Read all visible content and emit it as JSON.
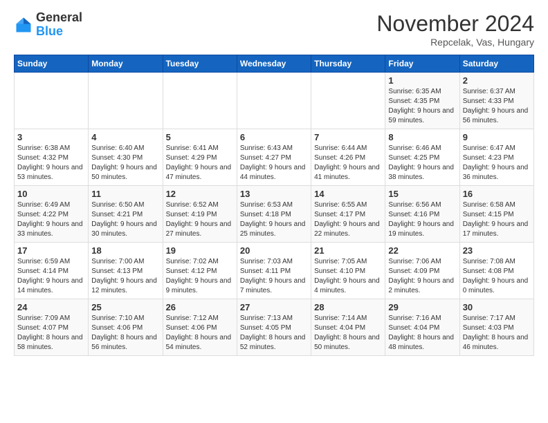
{
  "logo": {
    "general": "General",
    "blue": "Blue"
  },
  "header": {
    "title": "November 2024",
    "location": "Repcelak, Vas, Hungary"
  },
  "weekdays": [
    "Sunday",
    "Monday",
    "Tuesday",
    "Wednesday",
    "Thursday",
    "Friday",
    "Saturday"
  ],
  "weeks": [
    [
      {
        "day": "",
        "info": ""
      },
      {
        "day": "",
        "info": ""
      },
      {
        "day": "",
        "info": ""
      },
      {
        "day": "",
        "info": ""
      },
      {
        "day": "",
        "info": ""
      },
      {
        "day": "1",
        "info": "Sunrise: 6:35 AM\nSunset: 4:35 PM\nDaylight: 9 hours and 59 minutes."
      },
      {
        "day": "2",
        "info": "Sunrise: 6:37 AM\nSunset: 4:33 PM\nDaylight: 9 hours and 56 minutes."
      }
    ],
    [
      {
        "day": "3",
        "info": "Sunrise: 6:38 AM\nSunset: 4:32 PM\nDaylight: 9 hours and 53 minutes."
      },
      {
        "day": "4",
        "info": "Sunrise: 6:40 AM\nSunset: 4:30 PM\nDaylight: 9 hours and 50 minutes."
      },
      {
        "day": "5",
        "info": "Sunrise: 6:41 AM\nSunset: 4:29 PM\nDaylight: 9 hours and 47 minutes."
      },
      {
        "day": "6",
        "info": "Sunrise: 6:43 AM\nSunset: 4:27 PM\nDaylight: 9 hours and 44 minutes."
      },
      {
        "day": "7",
        "info": "Sunrise: 6:44 AM\nSunset: 4:26 PM\nDaylight: 9 hours and 41 minutes."
      },
      {
        "day": "8",
        "info": "Sunrise: 6:46 AM\nSunset: 4:25 PM\nDaylight: 9 hours and 38 minutes."
      },
      {
        "day": "9",
        "info": "Sunrise: 6:47 AM\nSunset: 4:23 PM\nDaylight: 9 hours and 36 minutes."
      }
    ],
    [
      {
        "day": "10",
        "info": "Sunrise: 6:49 AM\nSunset: 4:22 PM\nDaylight: 9 hours and 33 minutes."
      },
      {
        "day": "11",
        "info": "Sunrise: 6:50 AM\nSunset: 4:21 PM\nDaylight: 9 hours and 30 minutes."
      },
      {
        "day": "12",
        "info": "Sunrise: 6:52 AM\nSunset: 4:19 PM\nDaylight: 9 hours and 27 minutes."
      },
      {
        "day": "13",
        "info": "Sunrise: 6:53 AM\nSunset: 4:18 PM\nDaylight: 9 hours and 25 minutes."
      },
      {
        "day": "14",
        "info": "Sunrise: 6:55 AM\nSunset: 4:17 PM\nDaylight: 9 hours and 22 minutes."
      },
      {
        "day": "15",
        "info": "Sunrise: 6:56 AM\nSunset: 4:16 PM\nDaylight: 9 hours and 19 minutes."
      },
      {
        "day": "16",
        "info": "Sunrise: 6:58 AM\nSunset: 4:15 PM\nDaylight: 9 hours and 17 minutes."
      }
    ],
    [
      {
        "day": "17",
        "info": "Sunrise: 6:59 AM\nSunset: 4:14 PM\nDaylight: 9 hours and 14 minutes."
      },
      {
        "day": "18",
        "info": "Sunrise: 7:00 AM\nSunset: 4:13 PM\nDaylight: 9 hours and 12 minutes."
      },
      {
        "day": "19",
        "info": "Sunrise: 7:02 AM\nSunset: 4:12 PM\nDaylight: 9 hours and 9 minutes."
      },
      {
        "day": "20",
        "info": "Sunrise: 7:03 AM\nSunset: 4:11 PM\nDaylight: 9 hours and 7 minutes."
      },
      {
        "day": "21",
        "info": "Sunrise: 7:05 AM\nSunset: 4:10 PM\nDaylight: 9 hours and 4 minutes."
      },
      {
        "day": "22",
        "info": "Sunrise: 7:06 AM\nSunset: 4:09 PM\nDaylight: 9 hours and 2 minutes."
      },
      {
        "day": "23",
        "info": "Sunrise: 7:08 AM\nSunset: 4:08 PM\nDaylight: 9 hours and 0 minutes."
      }
    ],
    [
      {
        "day": "24",
        "info": "Sunrise: 7:09 AM\nSunset: 4:07 PM\nDaylight: 8 hours and 58 minutes."
      },
      {
        "day": "25",
        "info": "Sunrise: 7:10 AM\nSunset: 4:06 PM\nDaylight: 8 hours and 56 minutes."
      },
      {
        "day": "26",
        "info": "Sunrise: 7:12 AM\nSunset: 4:06 PM\nDaylight: 8 hours and 54 minutes."
      },
      {
        "day": "27",
        "info": "Sunrise: 7:13 AM\nSunset: 4:05 PM\nDaylight: 8 hours and 52 minutes."
      },
      {
        "day": "28",
        "info": "Sunrise: 7:14 AM\nSunset: 4:04 PM\nDaylight: 8 hours and 50 minutes."
      },
      {
        "day": "29",
        "info": "Sunrise: 7:16 AM\nSunset: 4:04 PM\nDaylight: 8 hours and 48 minutes."
      },
      {
        "day": "30",
        "info": "Sunrise: 7:17 AM\nSunset: 4:03 PM\nDaylight: 8 hours and 46 minutes."
      }
    ]
  ]
}
